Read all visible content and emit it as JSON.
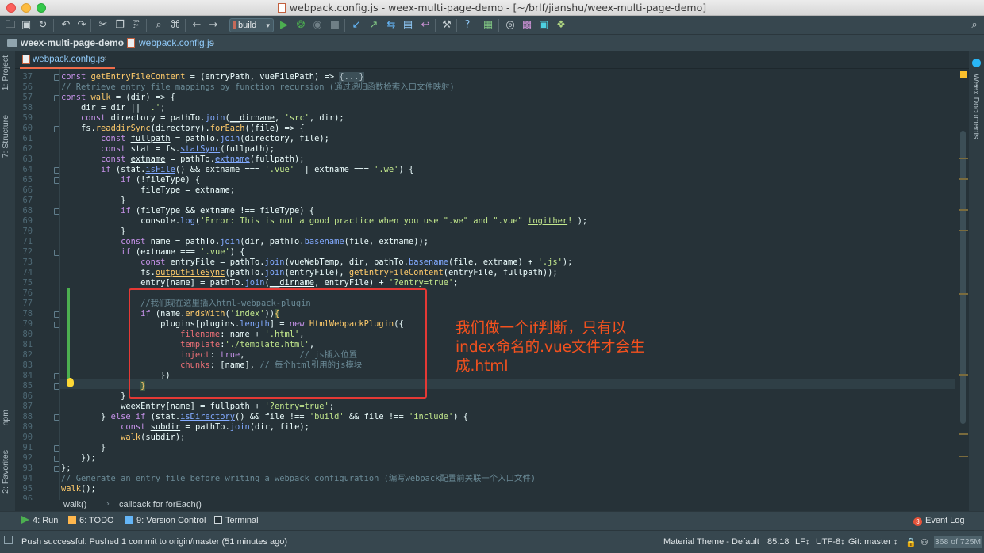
{
  "window": {
    "title": "webpack.config.js - weex-multi-page-demo - [~/brlf/jianshu/weex-multi-page-demo]"
  },
  "toolbar": {
    "run_config": "build"
  },
  "navbar": {
    "project": "weex-multi-page-demo",
    "file": "webpack.config.js"
  },
  "tab": {
    "label": "webpack.config.js",
    "close": "×"
  },
  "left_tools": {
    "project": "1: Project",
    "structure": "7: Structure",
    "npm": "npm",
    "favorites": "2: Favorites"
  },
  "right_tools": {
    "weex_docs": "Weex Documents"
  },
  "editor": {
    "annotation": "我们做一个if判断，只有以index命名的.vue文件才会生成.html",
    "lines": [
      {
        "n": "37",
        "html": "<span class=\"kw\">const</span> <span class=\"fnd\">getEntryFileContent</span> = (entryPath, vueFilePath) =&gt; <span class=\"fold-box\">{...}</span>"
      },
      {
        "n": "56",
        "html": "<span class=\"cm\">// Retrieve entry file mappings by function recursion (通过递归函数检索入口文件映射)</span>"
      },
      {
        "n": "57",
        "html": "<span class=\"kw\">const</span> <span class=\"fnd\">walk</span> = (dir) =&gt; {"
      },
      {
        "n": "58",
        "html": "    dir = dir || <span class=\"str\">'.'</span>;"
      },
      {
        "n": "59",
        "html": "    <span class=\"kw\">const</span> directory = pathTo.<span class=\"fn\">join</span>(<span class=\"ul\">__dirname</span>, <span class=\"str\">'src'</span>, dir);"
      },
      {
        "n": "60",
        "html": "    fs.<span class=\"fnd ul\">readdirSync</span>(directory).<span class=\"fnd\">forEach</span>((file) =&gt; {"
      },
      {
        "n": "61",
        "html": "        <span class=\"kw\">const</span> <span class=\"ul\">fullpath</span> = pathTo.<span class=\"fn\">join</span>(directory, file);"
      },
      {
        "n": "62",
        "html": "        <span class=\"kw\">const</span> stat = fs.<span class=\"fn ul\">statSync</span>(fullpath);"
      },
      {
        "n": "63",
        "html": "        <span class=\"kw\">const</span> <span class=\"ul\">extname</span> = pathTo.<span class=\"fn ul\">extname</span>(fullpath);"
      },
      {
        "n": "64",
        "html": "        <span class=\"kw\">if</span> (stat.<span class=\"fn ul\">isFile</span>() &amp;&amp; extname === <span class=\"str\">'.vue'</span> || extname === <span class=\"str\">'.we'</span>) {"
      },
      {
        "n": "65",
        "html": "            <span class=\"kw\">if</span> (!fileType) {"
      },
      {
        "n": "66",
        "html": "                fileType = extname;"
      },
      {
        "n": "67",
        "html": "            }"
      },
      {
        "n": "68",
        "html": "            <span class=\"kw\">if</span> (fileType &amp;&amp; extname !== fileType) {"
      },
      {
        "n": "69",
        "html": "                console.<span class=\"fn\">log</span>(<span class=\"str\">'Error: This is not a good practice when you use \".we\" and \".vue\" <span class=\"ul\">togither</span>!'</span>);"
      },
      {
        "n": "70",
        "html": "            }"
      },
      {
        "n": "71",
        "html": "            <span class=\"kw\">const</span> name = pathTo.<span class=\"fn\">join</span>(dir, pathTo.<span class=\"fn\">basename</span>(file, extname));"
      },
      {
        "n": "72",
        "html": "            <span class=\"kw\">if</span> (extname === <span class=\"str\">'.vue'</span>) {"
      },
      {
        "n": "73",
        "html": "                <span class=\"kw\">const</span> entryFile = pathTo.<span class=\"fn\">join</span>(vueWebTemp, dir, pathTo.<span class=\"fn\">basename</span>(file, extname) + <span class=\"str\">'.js'</span>);"
      },
      {
        "n": "74",
        "html": "                fs.<span class=\"fnd ul\">outputFileSync</span>(pathTo.<span class=\"fn\">join</span>(entryFile), <span class=\"fnd\">getEntryFileContent</span>(entryFile, fullpath));"
      },
      {
        "n": "75",
        "html": "                entry[name] = pathTo.<span class=\"fn\">join</span>(<span class=\"ul\">__dirname</span>, entryFile) + <span class=\"str\">'?entry=true'</span>;"
      },
      {
        "n": "76",
        "html": ""
      },
      {
        "n": "77",
        "html": "                <span class=\"cm\">//我们现在这里插入html-webpack-plugin</span>"
      },
      {
        "n": "78",
        "html": "                <span class=\"kw\">if</span> (name.<span class=\"fnd\">endsWith</span>(<span class=\"str\">'index'</span>))<span class=\"br\">{</span>"
      },
      {
        "n": "79",
        "html": "                    plugins[plugins.<span class=\"fn\">length</span>] = <span class=\"kw\">new</span> <span class=\"fnd\">HtmlWebpackPlugin</span>({"
      },
      {
        "n": "80",
        "html": "                        <span class=\"prop\">filename</span>: name + <span class=\"str\">'.html'</span>,"
      },
      {
        "n": "81",
        "html": "                        <span class=\"prop\">template</span>:<span class=\"str\">'./template.html'</span>,"
      },
      {
        "n": "82",
        "html": "                        <span class=\"prop\">inject</span>: <span class=\"kw\">true</span>,           <span class=\"cm\">// js插入位置</span>"
      },
      {
        "n": "83",
        "html": "                        <span class=\"prop\">chunks</span>: [name], <span class=\"cm\">// 每个html引用的js模块</span>"
      },
      {
        "n": "84",
        "html": "                    })"
      },
      {
        "n": "85",
        "html": "                <span class=\"br\">}</span>"
      },
      {
        "n": "86",
        "html": "            }"
      },
      {
        "n": "87",
        "html": "            weexEntry[name] = fullpath + <span class=\"str\">'?entry=true'</span>;"
      },
      {
        "n": "88",
        "html": "        } <span class=\"kw\">else if</span> (stat.<span class=\"fn ul\">isDirectory</span>() &amp;&amp; file !== <span class=\"str\">'build'</span> &amp;&amp; file !== <span class=\"str\">'include'</span>) {"
      },
      {
        "n": "89",
        "html": "            <span class=\"kw\">const</span> <span class=\"ul\">subdir</span> = pathTo.<span class=\"fn\">join</span>(dir, file);"
      },
      {
        "n": "90",
        "html": "            <span class=\"fnd\">walk</span>(subdir);"
      },
      {
        "n": "91",
        "html": "        }"
      },
      {
        "n": "92",
        "html": "    });"
      },
      {
        "n": "93",
        "html": "};"
      },
      {
        "n": "94",
        "html": "<span class=\"cm\">// Generate an entry file before writing a webpack configuration (编写webpack配置前关联一个入口文件)</span>"
      },
      {
        "n": "95",
        "html": "<span class=\"fnd\">walk</span>();"
      },
      {
        "n": "96",
        "html": ""
      }
    ]
  },
  "code_crumbs": {
    "fn": "walk()",
    "callback": "callback for forEach()"
  },
  "tool_windows": {
    "run": "4: Run",
    "todo": "6: TODO",
    "vcs": "9: Version Control",
    "terminal": "Terminal",
    "event_count": "3",
    "event_log": "Event Log"
  },
  "status": {
    "message": "Push successful: Pushed 1 commit to origin/master (51 minutes ago)",
    "theme": "Material Theme - Default",
    "position": "85:18",
    "line_sep": "LF↕",
    "encoding": "UTF-8↕",
    "git": "Git: master ↕",
    "memory": "368 of 725M"
  },
  "colors": {
    "accent": "#ef6c4a",
    "annotation": "#f4511e",
    "highlight_box": "#e53935",
    "editor_bg": "#263238"
  }
}
